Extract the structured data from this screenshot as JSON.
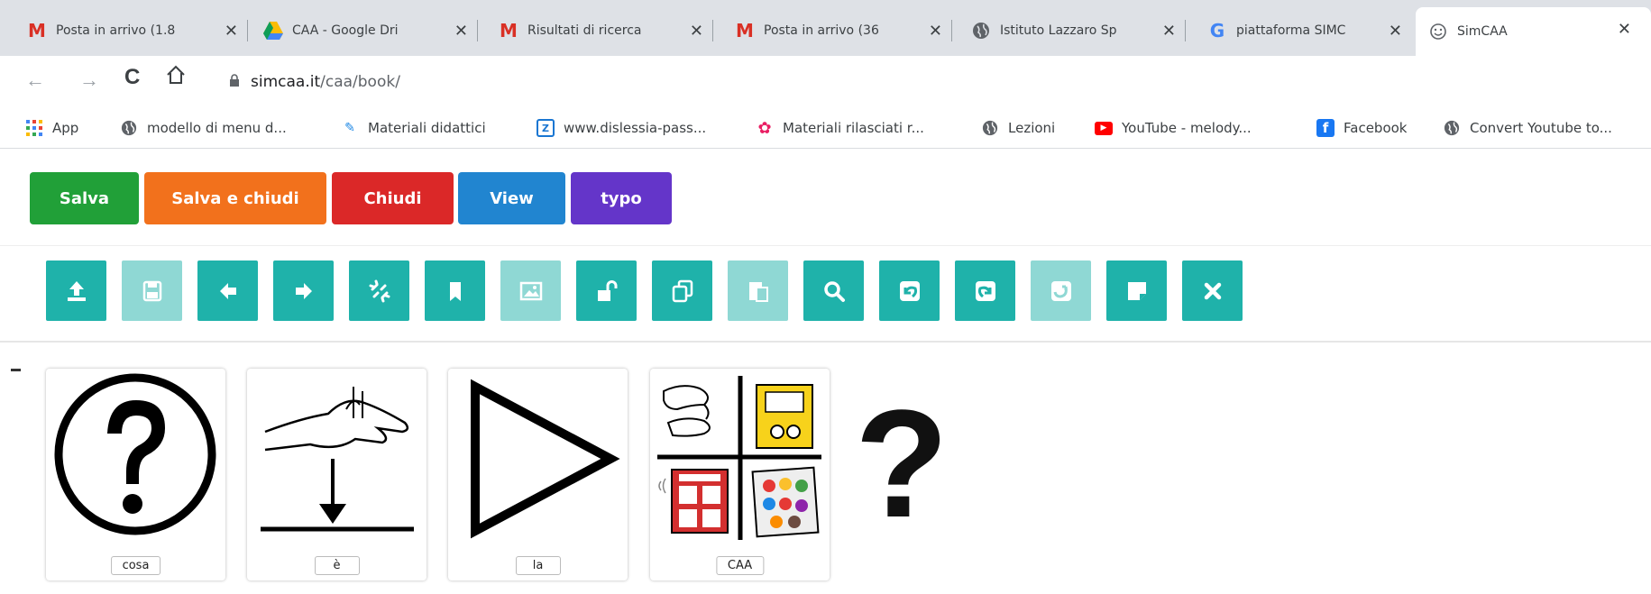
{
  "browser": {
    "tabs": [
      {
        "label": "Posta in arrivo (1.8",
        "icon": "gmail-icon"
      },
      {
        "label": "CAA - Google Dri",
        "icon": "google-drive-icon"
      },
      {
        "label": "Risultati di ricerca",
        "icon": "gmail-icon"
      },
      {
        "label": "Posta in arrivo (36",
        "icon": "gmail-icon"
      },
      {
        "label": "Istituto Lazzaro Sp",
        "icon": "globe-icon"
      },
      {
        "label": "piattaforma SIMC",
        "icon": "google-icon"
      },
      {
        "label": "SimCAA",
        "icon": "simcaa-icon",
        "active": true
      }
    ],
    "close_glyph": "✕",
    "url_host": "simcaa.it",
    "url_path": "/caa/book/",
    "bookmarks": [
      {
        "label": "App",
        "icon": "apps-grid-icon"
      },
      {
        "label": "modello di menu d...",
        "icon": "globe-icon"
      },
      {
        "label": "Materiali didattici",
        "icon": "materiali-icon"
      },
      {
        "label": "www.dislessia-pass...",
        "icon": "dislessia-icon"
      },
      {
        "label": "Materiali rilasciati r...",
        "icon": "flower-icon"
      },
      {
        "label": "Lezioni",
        "icon": "globe-icon"
      },
      {
        "label": "YouTube - melody...",
        "icon": "youtube-icon"
      },
      {
        "label": "Facebook",
        "icon": "facebook-icon"
      },
      {
        "label": "Convert Youtube to...",
        "icon": "globe-icon"
      }
    ]
  },
  "app": {
    "buttons": [
      {
        "label": "Salva",
        "color": "#21a038"
      },
      {
        "label": "Salva e chiudi",
        "color": "#f2711c"
      },
      {
        "label": "Chiudi",
        "color": "#db2828"
      },
      {
        "label": "View",
        "color": "#2185d0"
      },
      {
        "label": "typo",
        "color": "#6435c9"
      }
    ],
    "toolbar_icons": [
      {
        "name": "upload-icon",
        "enabled": true
      },
      {
        "name": "save-icon",
        "enabled": false
      },
      {
        "name": "arrow-left-icon",
        "enabled": true
      },
      {
        "name": "arrow-right-icon",
        "enabled": true
      },
      {
        "name": "unlink-icon",
        "enabled": true
      },
      {
        "name": "bookmark-icon",
        "enabled": true
      },
      {
        "name": "image-icon",
        "enabled": false
      },
      {
        "name": "unlock-icon",
        "enabled": true
      },
      {
        "name": "copy-icon",
        "enabled": true
      },
      {
        "name": "paste-icon",
        "enabled": false
      },
      {
        "name": "search-icon",
        "enabled": true
      },
      {
        "name": "undo-icon",
        "enabled": true
      },
      {
        "name": "redo-icon",
        "enabled": true
      },
      {
        "name": "refresh-icon",
        "enabled": false
      },
      {
        "name": "note-icon",
        "enabled": true
      },
      {
        "name": "close-icon",
        "enabled": true
      }
    ],
    "toolbar_color_enabled": "#1fb2aa",
    "toolbar_color_disabled": "#8fd8d4",
    "cards": [
      {
        "label": "cosa",
        "symbol": "question-circle-symbol"
      },
      {
        "label": "è",
        "symbol": "hand-sign-symbol"
      },
      {
        "label": "la",
        "symbol": "play-triangle-symbol"
      },
      {
        "label": "CAA",
        "symbol": "caa-composite-symbol"
      }
    ],
    "trailing_punctuation": "?"
  }
}
